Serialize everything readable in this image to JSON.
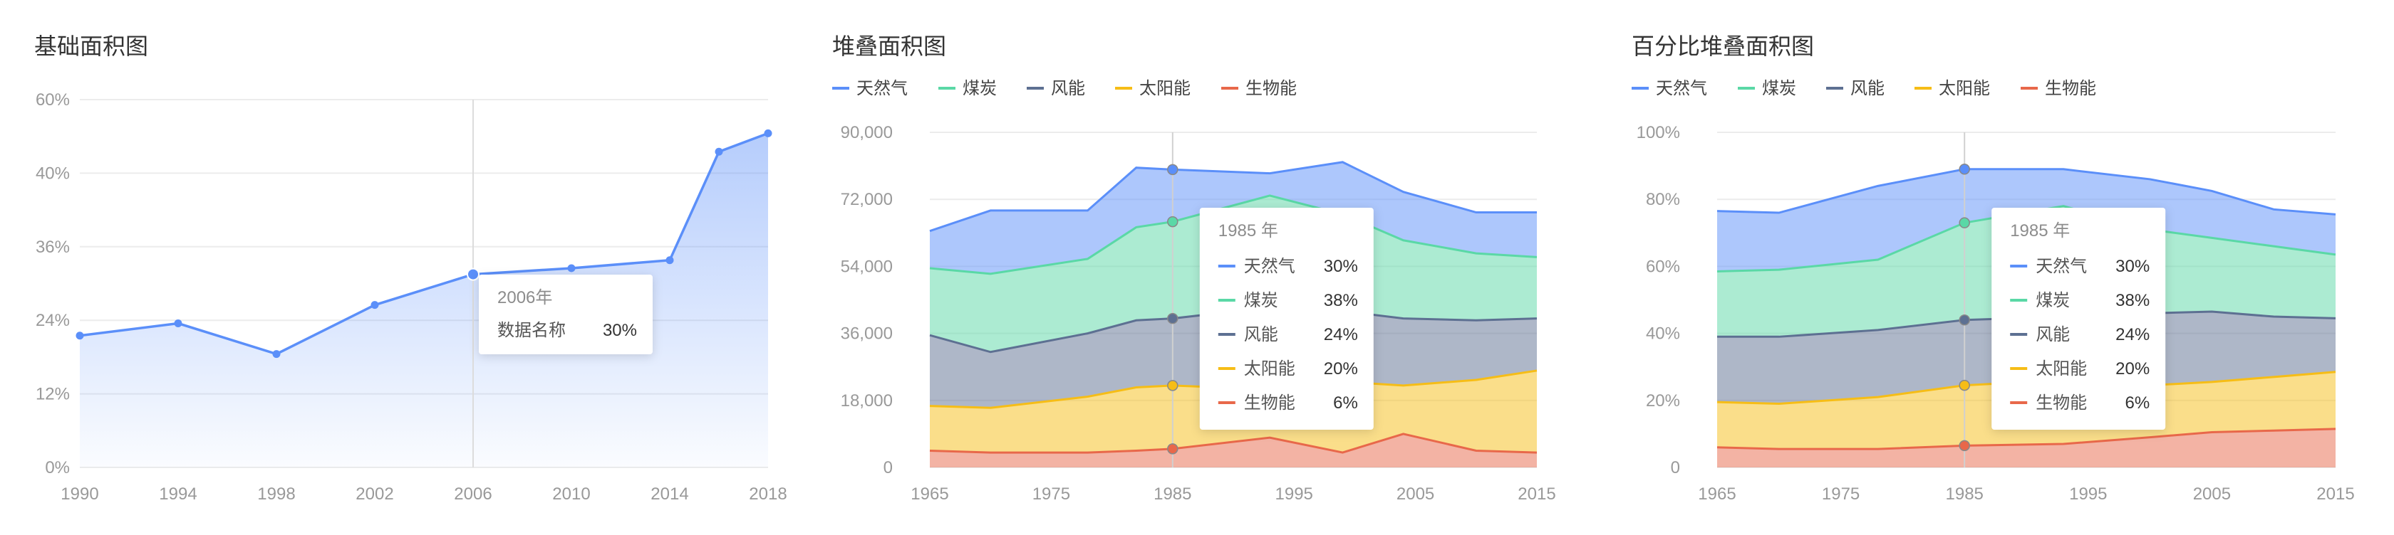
{
  "colors": {
    "natural_gas": "#5b8ff9",
    "coal": "#5ad8a6",
    "wind": "#5d7092",
    "solar": "#f6bd16",
    "biomass": "#e8684a",
    "grid": "#ececec",
    "axis_text": "#999999"
  },
  "chart_data": [
    {
      "type": "area",
      "title": "基础面积图",
      "xlabel": "",
      "ylabel": "",
      "x": [
        1990,
        1994,
        1998,
        2002,
        2006,
        2010,
        2014,
        2016,
        2018
      ],
      "x_ticks": [
        "1990",
        "1994",
        "1998",
        "2002",
        "2006",
        "2010",
        "2014",
        "2018"
      ],
      "y_ticks": [
        "0%",
        "12%",
        "24%",
        "36%",
        "40%",
        "60%"
      ],
      "series": [
        {
          "values": [
            21.5,
            23.5,
            18.5,
            26.5,
            31.5,
            32.5,
            33.8,
            51.5,
            54.5
          ]
        }
      ],
      "grid": true,
      "legend": "none",
      "tooltip": {
        "title": "2006年",
        "items": [
          {
            "label": "数据名称",
            "value": "30%"
          }
        ]
      },
      "highlight_index": 4
    },
    {
      "type": "area",
      "title": "堆叠面积图",
      "xlabel": "",
      "ylabel": "",
      "stacked": true,
      "x": [
        1965,
        1970,
        1978,
        1982,
        1985,
        1993,
        1999,
        2004,
        2010,
        2015
      ],
      "x_ticks": [
        "1965",
        "1975",
        "1985",
        "1995",
        "2005",
        "2015"
      ],
      "ylim": [
        0,
        90000
      ],
      "y_ticks": [
        "0",
        "18,000",
        "36,000",
        "54,000",
        "72,000",
        "90,000"
      ],
      "series": [
        {
          "name": "生物能",
          "color_key": "biomass",
          "values": [
            4500,
            4000,
            4000,
            4500,
            5000,
            8000,
            4000,
            9000,
            4500,
            4000
          ]
        },
        {
          "name": "太阳能",
          "color_key": "solar",
          "values": [
            12000,
            12000,
            15000,
            17000,
            17000,
            13000,
            19000,
            13000,
            19000,
            22000
          ]
        },
        {
          "name": "风能",
          "color_key": "wind",
          "values": [
            19000,
            15000,
            17000,
            18000,
            18000,
            22000,
            19000,
            18000,
            16000,
            14000
          ]
        },
        {
          "name": "煤炭",
          "color_key": "coal",
          "values": [
            18000,
            21000,
            20000,
            25000,
            26000,
            30000,
            26000,
            21000,
            18000,
            16500
          ]
        },
        {
          "name": "天然气",
          "color_key": "natural_gas",
          "values": [
            10000,
            17000,
            13000,
            16000,
            14000,
            6000,
            14000,
            13000,
            11000,
            12000
          ]
        }
      ],
      "legend_order": [
        "天然气",
        "煤炭",
        "风能",
        "太阳能",
        "生物能"
      ],
      "grid": true,
      "legend": "top-left",
      "tooltip": {
        "title": "1985 年",
        "items": [
          {
            "label": "天然气",
            "value": "30%",
            "color_key": "natural_gas"
          },
          {
            "label": "煤炭",
            "value": "38%",
            "color_key": "coal"
          },
          {
            "label": "风能",
            "value": "24%",
            "color_key": "wind"
          },
          {
            "label": "太阳能",
            "value": "20%",
            "color_key": "solar"
          },
          {
            "label": "生物能",
            "value": "6%",
            "color_key": "biomass"
          }
        ]
      },
      "highlight_index": 4
    },
    {
      "type": "area",
      "title": "百分比堆叠面积图",
      "xlabel": "",
      "ylabel": "",
      "stacked": true,
      "x": [
        1965,
        1970,
        1978,
        1985,
        1993,
        2000,
        2005,
        2010,
        2015
      ],
      "x_ticks": [
        "1965",
        "1975",
        "1985",
        "1995",
        "2005",
        "2015"
      ],
      "ylim": [
        0,
        100
      ],
      "y_ticks": [
        "0",
        "20%",
        "40%",
        "60%",
        "80%",
        "100%"
      ],
      "series": [
        {
          "name": "生物能",
          "color_key": "biomass",
          "values": [
            6,
            5.5,
            5.5,
            6.5,
            7,
            9,
            10.5,
            11,
            11.5
          ]
        },
        {
          "name": "太阳能",
          "color_key": "solar",
          "values": [
            13.5,
            13.5,
            15.5,
            18,
            19,
            15.5,
            15,
            16,
            17
          ]
        },
        {
          "name": "风能",
          "color_key": "wind",
          "values": [
            19.5,
            20,
            20,
            19.5,
            19,
            21.5,
            21,
            18,
            16
          ]
        },
        {
          "name": "煤炭",
          "color_key": "coal",
          "values": [
            19.5,
            20,
            21,
            29,
            33,
            25,
            22,
            21,
            19
          ]
        },
        {
          "name": "天然气",
          "color_key": "natural_gas",
          "values": [
            18,
            17,
            22,
            16,
            11,
            15,
            14,
            11,
            12
          ]
        }
      ],
      "legend_order": [
        "天然气",
        "煤炭",
        "风能",
        "太阳能",
        "生物能"
      ],
      "grid": true,
      "legend": "top-left",
      "tooltip": {
        "title": "1985 年",
        "items": [
          {
            "label": "天然气",
            "value": "30%",
            "color_key": "natural_gas"
          },
          {
            "label": "煤炭",
            "value": "38%",
            "color_key": "coal"
          },
          {
            "label": "风能",
            "value": "24%",
            "color_key": "wind"
          },
          {
            "label": "太阳能",
            "value": "20%",
            "color_key": "solar"
          },
          {
            "label": "生物能",
            "value": "6%",
            "color_key": "biomass"
          }
        ]
      },
      "highlight_index": 3
    }
  ]
}
